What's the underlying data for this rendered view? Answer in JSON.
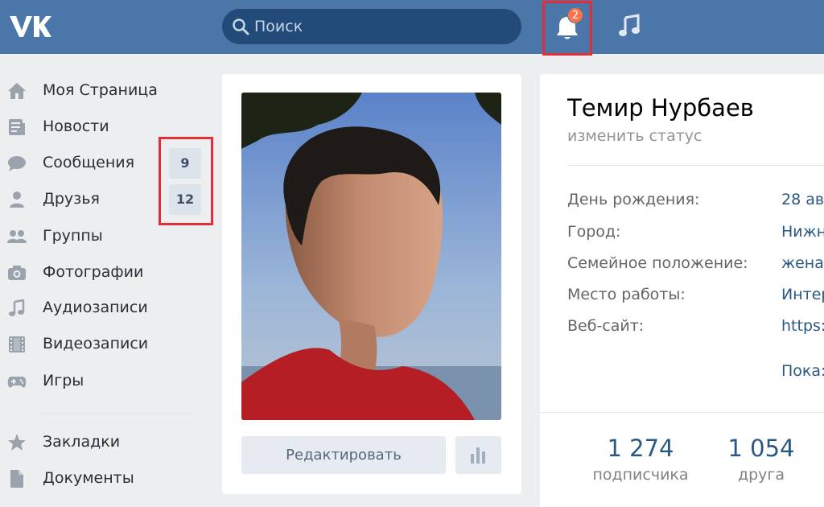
{
  "header": {
    "search": {
      "placeholder": "Поиск"
    },
    "notifications": {
      "count": "2"
    }
  },
  "sidebar": {
    "items": [
      {
        "label": "Моя Страница",
        "icon": "home-icon"
      },
      {
        "label": "Новости",
        "icon": "news-icon"
      },
      {
        "label": "Сообщения",
        "icon": "messages-icon",
        "count": "9"
      },
      {
        "label": "Друзья",
        "icon": "friends-icon",
        "count": "12"
      },
      {
        "label": "Группы",
        "icon": "groups-icon"
      },
      {
        "label": "Фотографии",
        "icon": "camera-icon"
      },
      {
        "label": "Аудиозаписи",
        "icon": "music-note-icon"
      },
      {
        "label": "Видеозаписи",
        "icon": "film-icon"
      },
      {
        "label": "Игры",
        "icon": "gamepad-icon"
      },
      {
        "label": "Закладки",
        "icon": "star-icon"
      },
      {
        "label": "Документы",
        "icon": "document-icon"
      }
    ]
  },
  "profile": {
    "edit_label": "Редактировать",
    "name": "Темир Нурбаев",
    "status_prompt": "изменить статус",
    "info": [
      {
        "label": "День рождения:",
        "value": "28 ав"
      },
      {
        "label": "Город:",
        "value": "Нижн"
      },
      {
        "label": "Семейное положение:",
        "value": "жена"
      },
      {
        "label": "Место работы:",
        "value": "Интер"
      },
      {
        "label": "Веб-сайт:",
        "value": "https:"
      }
    ],
    "show_more": "Пока:",
    "counters": [
      {
        "value": "1 274",
        "label": "подписчика"
      },
      {
        "value": "1 054",
        "label": "друга"
      }
    ]
  },
  "colors": {
    "header": "#4a76a8",
    "page_bg": "#edeef0",
    "link": "#2a5885",
    "highlight_frame": "#e42d35",
    "badge": "#ff734c"
  }
}
